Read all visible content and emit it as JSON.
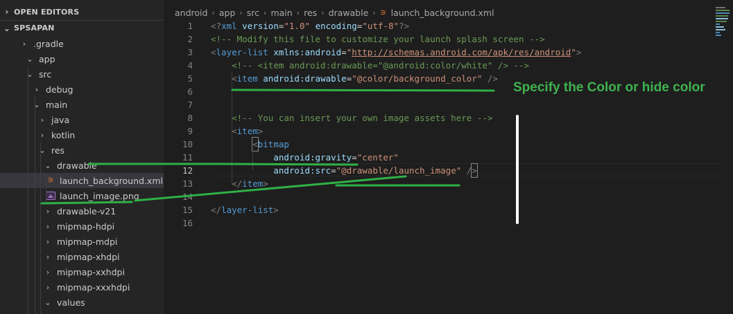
{
  "sidebar": {
    "open_editors_label": "OPEN EDITORS",
    "project_label": "SPSAPAN",
    "tree": [
      {
        "label": ".gradle",
        "state": "collapsed"
      },
      {
        "label": "app",
        "state": "expanded"
      },
      {
        "label": "src",
        "state": "expanded"
      },
      {
        "label": "debug",
        "state": "collapsed"
      },
      {
        "label": "main",
        "state": "expanded"
      },
      {
        "label": "java",
        "state": "collapsed"
      },
      {
        "label": "kotlin",
        "state": "collapsed"
      },
      {
        "label": "res",
        "state": "expanded"
      },
      {
        "label": "drawable",
        "state": "expanded"
      },
      {
        "label": "launch_background.xml",
        "state": "file-xml",
        "icon": "rss-icon",
        "selected": true
      },
      {
        "label": "launch_image.png",
        "state": "file-png",
        "icon": "image-icon"
      },
      {
        "label": "drawable-v21",
        "state": "collapsed"
      },
      {
        "label": "mipmap-hdpi",
        "state": "collapsed"
      },
      {
        "label": "mipmap-mdpi",
        "state": "collapsed"
      },
      {
        "label": "mipmap-xhdpi",
        "state": "collapsed"
      },
      {
        "label": "mipmap-xxhdpi",
        "state": "collapsed"
      },
      {
        "label": "mipmap-xxxhdpi",
        "state": "collapsed"
      },
      {
        "label": "values",
        "state": "expanded"
      }
    ]
  },
  "breadcrumb": {
    "parts": [
      "android",
      "app",
      "src",
      "main",
      "res",
      "drawable"
    ],
    "file": "launch_background.xml"
  },
  "editor": {
    "active_line": 12,
    "lines": [
      {
        "n": "1",
        "tokens": [
          [
            "punct",
            "<?"
          ],
          [
            "tag",
            "xml"
          ],
          [
            "sp",
            " "
          ],
          [
            "attr",
            "version"
          ],
          [
            "eq",
            "="
          ],
          [
            "str",
            "\"1.0\""
          ],
          [
            "sp",
            " "
          ],
          [
            "attr",
            "encoding"
          ],
          [
            "eq",
            "="
          ],
          [
            "str",
            "\"utf-8\""
          ],
          [
            "punct",
            "?>"
          ]
        ]
      },
      {
        "n": "2",
        "tokens": [
          [
            "comment",
            "<!-- Modify this file to customize your launch splash screen -->"
          ]
        ]
      },
      {
        "n": "3",
        "tokens": [
          [
            "punct",
            "<"
          ],
          [
            "tag",
            "layer-list"
          ],
          [
            "sp",
            " "
          ],
          [
            "attr",
            "xmlns:android"
          ],
          [
            "eq",
            "="
          ],
          [
            "str",
            "\""
          ],
          [
            "url",
            "http://schemas.android.com/apk/res/android"
          ],
          [
            "str",
            "\""
          ],
          [
            "punct",
            ">"
          ]
        ]
      },
      {
        "n": "4",
        "tokens": [
          [
            "sp",
            "    "
          ],
          [
            "comment",
            "<!-- <item android:drawable=\"@android:color/white\" /> -->"
          ]
        ]
      },
      {
        "n": "5",
        "tokens": [
          [
            "sp",
            "    "
          ],
          [
            "punct",
            "<"
          ],
          [
            "tag",
            "item"
          ],
          [
            "sp",
            " "
          ],
          [
            "attr",
            "android:drawable"
          ],
          [
            "eq",
            "="
          ],
          [
            "str",
            "\"@color/background_color\""
          ],
          [
            "sp",
            " "
          ],
          [
            "punct",
            "/>"
          ]
        ]
      },
      {
        "n": "6",
        "tokens": []
      },
      {
        "n": "7",
        "tokens": []
      },
      {
        "n": "8",
        "tokens": [
          [
            "sp",
            "    "
          ],
          [
            "comment",
            "<!-- You can insert your own image assets here -->"
          ]
        ]
      },
      {
        "n": "9",
        "tokens": [
          [
            "sp",
            "    "
          ],
          [
            "punct",
            "<"
          ],
          [
            "tag",
            "item"
          ],
          [
            "punct",
            ">"
          ]
        ]
      },
      {
        "n": "10",
        "tokens": [
          [
            "sp",
            "        "
          ],
          [
            "punctbox",
            "<"
          ],
          [
            "tag",
            "bitmap"
          ]
        ]
      },
      {
        "n": "11",
        "tokens": [
          [
            "sp",
            "            "
          ],
          [
            "attr",
            "android:gravity"
          ],
          [
            "eq",
            "="
          ],
          [
            "str",
            "\"center\""
          ]
        ]
      },
      {
        "n": "12",
        "tokens": [
          [
            "sp",
            "            "
          ],
          [
            "attr",
            "android:src"
          ],
          [
            "eq",
            "="
          ],
          [
            "str",
            "\"@drawable/launch_image\""
          ],
          [
            "sp",
            " "
          ],
          [
            "punct",
            "/"
          ],
          [
            "punctbox",
            ">"
          ]
        ]
      },
      {
        "n": "13",
        "tokens": [
          [
            "sp",
            "    "
          ],
          [
            "punct",
            "</"
          ],
          [
            "tag",
            "item"
          ],
          [
            "punct",
            ">"
          ]
        ]
      },
      {
        "n": "14",
        "tokens": []
      },
      {
        "n": "15",
        "tokens": [
          [
            "punct",
            "</"
          ],
          [
            "tag",
            "layer-list"
          ],
          [
            "punct",
            ">"
          ]
        ]
      },
      {
        "n": "16",
        "tokens": []
      }
    ]
  },
  "annotation": {
    "text": "Specify the Color or hide color",
    "color": "#3fb34f"
  },
  "colors": {
    "sidebar_bg": "#252526",
    "editor_bg": "#1e1e1e",
    "selection_bg": "#37373d",
    "tag": "#569cd6",
    "attr": "#9cdcfe",
    "string": "#ce9178",
    "comment": "#6a9955",
    "annotation_green": "#3fb34f"
  }
}
